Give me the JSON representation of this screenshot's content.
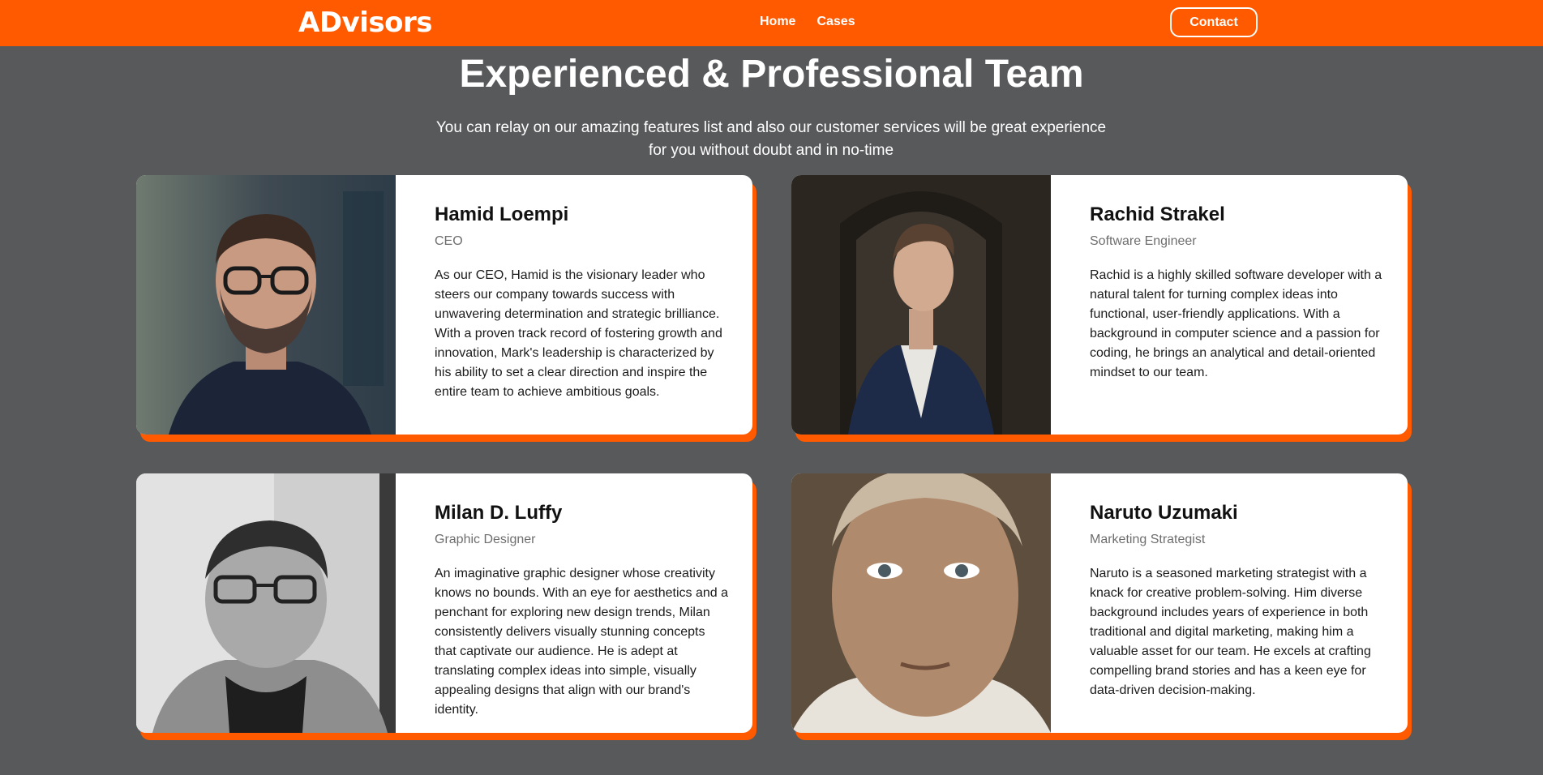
{
  "header": {
    "logo": "ADvisors",
    "nav": [
      "Home",
      "Cases"
    ],
    "contact_label": "Contact"
  },
  "main": {
    "title": "Experienced & Professional Team",
    "subtitle": "You can relay on our amazing features list and also our customer services will be great experience for you without doubt and in no-time"
  },
  "team": [
    {
      "name": "Hamid Loempi",
      "role": "CEO",
      "bio": "As our CEO, Hamid is the visionary leader who steers our company towards success with unwavering determination and strategic brilliance. With a proven track record of fostering growth and innovation, Mark's leadership is characterized by his ability to set a clear direction and inspire the entire team to achieve ambitious goals."
    },
    {
      "name": "Rachid Strakel",
      "role": "Software Engineer",
      "bio": "Rachid is a highly skilled software developer with a natural talent for turning complex ideas into functional, user-friendly applications. With a background in computer science and a passion for coding, he brings an analytical and detail-oriented mindset to our team."
    },
    {
      "name": "Milan D. Luffy",
      "role": "Graphic Designer",
      "bio": "An imaginative graphic designer whose creativity knows no bounds. With an eye for aesthetics and a penchant for exploring new design trends, Milan consistently delivers visually stunning concepts that captivate our audience. He is adept at translating complex ideas into simple, visually appealing designs that align with our brand's identity."
    },
    {
      "name": "Naruto Uzumaki",
      "role": "Marketing Strategist",
      "bio": "Naruto is a seasoned marketing strategist with a knack for creative problem-solving. Him diverse background includes years of experience in both traditional and digital marketing, making him a valuable asset for our team. He excels at crafting compelling brand stories and has a keen eye for data-driven decision-making."
    }
  ],
  "colors": {
    "accent": "#ff5a00",
    "background": "#58595b",
    "card": "#ffffff"
  }
}
